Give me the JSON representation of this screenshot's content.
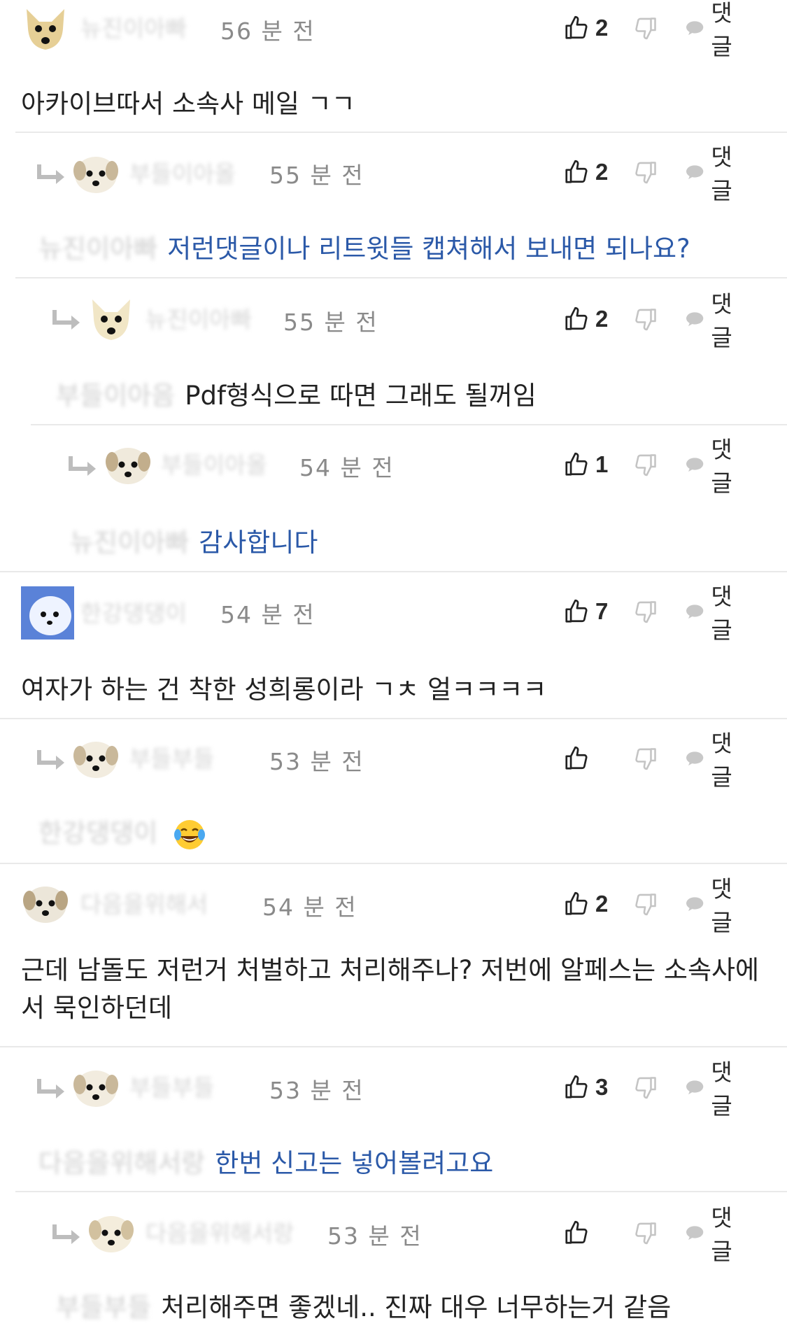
{
  "comments": [
    {
      "author": "뉴진이아빠",
      "time": "56 분 전",
      "likes": "2",
      "reply_label": "댓글",
      "mention": "",
      "text": "아카이브따서 소속사 메일 ㄱㄱ"
    },
    {
      "author": "부들이아올",
      "time": "55 분 전",
      "likes": "2",
      "reply_label": "댓글",
      "mention": "뉴진이아빠",
      "text": "저런댓글이나 리트윗들 캡쳐해서 보내면 되나요?"
    },
    {
      "author": "뉴진이아빠",
      "time": "55 분 전",
      "likes": "2",
      "reply_label": "댓글",
      "mention": "부들이아음",
      "text": "Pdf형식으로 따면 그래도 될꺼임"
    },
    {
      "author": "부들이아올",
      "time": "54 분 전",
      "likes": "1",
      "reply_label": "댓글",
      "mention": "뉴진이아빠",
      "text": "감사합니다"
    },
    {
      "author": "한강댕댕이",
      "time": "54 분 전",
      "likes": "7",
      "reply_label": "댓글",
      "mention": "",
      "text": "여자가 하는 건 착한 성희롱이라 ㄱㅊ 얼ㅋㅋㅋㅋ"
    },
    {
      "author": "부들부들",
      "time": "53 분 전",
      "likes": "",
      "reply_label": "댓글",
      "mention": "한강댕댕이",
      "text": ""
    },
    {
      "author": "다음을위해서",
      "time": "54 분 전",
      "likes": "2",
      "reply_label": "댓글",
      "mention": "",
      "text": "근데 남돌도 저런거 처벌하고 처리해주나? 저번에 알페스는 소속사에서 묵인하던데"
    },
    {
      "author": "부들부들",
      "time": "53 분 전",
      "likes": "3",
      "reply_label": "댓글",
      "mention": "다음을위해서랑",
      "text": "한번 신고는 넣어볼려고요"
    },
    {
      "author": "다음을위해서랑",
      "time": "53 분 전",
      "likes": "",
      "reply_label": "댓글",
      "mention": "부들부들",
      "text": "처리해주면 좋겠네.. 진짜 대우 너무하는거 같음"
    }
  ],
  "icons": {
    "like": "thumbs-up-icon",
    "dislike": "thumbs-down-icon",
    "reply": "speech-bubble-icon",
    "reply_arrow": "reply-arrow-icon",
    "emoji": "laughing-tears-emoji"
  },
  "colors": {
    "mention_blue": "#2b59a8",
    "divider": "#e9e9e9",
    "time_gray": "#8a8a8a"
  }
}
